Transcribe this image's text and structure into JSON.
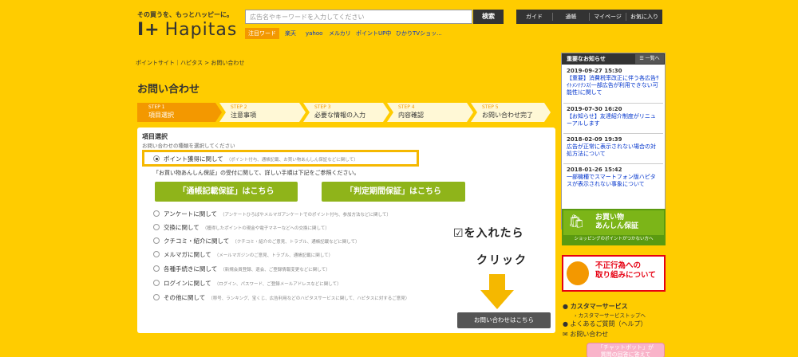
{
  "header": {
    "tagline": "その買うを、もっとハッピーに。",
    "logo": "Hapitas",
    "search_placeholder": "広告名やキーワードを入力してください",
    "search_button": "検索",
    "hotword_label": "注目ワード",
    "keywords": [
      "楽天",
      "yahoo",
      "メルカリ",
      "ポイントUP中",
      "ひかりTVショッ..."
    ],
    "nav": [
      "ガイド",
      "通帳",
      "マイページ",
      "お気に入り"
    ]
  },
  "breadcrumb": {
    "items": [
      "ポイントサイト｜ハピタス",
      "お問い合わせ"
    ],
    "separator": ">"
  },
  "page_title": "お問い合わせ",
  "steps": [
    {
      "num": "STEP 1",
      "label": "項目選択"
    },
    {
      "num": "STEP 2",
      "label": "注意事項"
    },
    {
      "num": "STEP 3",
      "label": "必要な情報の入力"
    },
    {
      "num": "STEP 4",
      "label": "内容確認"
    },
    {
      "num": "STEP 5",
      "label": "お問い合わせ完了"
    }
  ],
  "form": {
    "section_title": "項目選択",
    "section_sub": "お問い合わせの種類を選択してください",
    "selected_option": {
      "label": "ポイント獲得に関して",
      "note": "（ポイント付与、通帳記載、お買い物あんしん保証などに関して）"
    },
    "info_text": "「お買い物あんしん保証」の受付に関して、詳しい手順は下記をご参照ください。",
    "btn_bankbook": "「通帳記載保証」はこちら",
    "btn_judgement": "「判定期間保証」はこちら",
    "options": [
      {
        "label": "アンケートに関して",
        "note": "（アンケートひろばやメルマガアンケートでのポイント付与、参加方法などに関して）"
      },
      {
        "label": "交換に関して",
        "note": "（獲得したポイントの現金や電子マネーなどへの交換に関して）"
      },
      {
        "label": "クチコミ・紹介に関して",
        "note": "（クチコミ・紹介のご意見、トラブル、通帳記載などに関して）"
      },
      {
        "label": "メルマガに関して",
        "note": "（メールマガジンのご意見、トラブル、通帳記載に関して）"
      },
      {
        "label": "各種手続きに関して",
        "note": "（新規会員登録、退会、ご登録情報変更などに関して）"
      },
      {
        "label": "ログインに関して",
        "note": "（ログイン、パスワード、ご登録メールアドレスなどに関して）"
      },
      {
        "label": "その他に関して",
        "note": "（称号、ランキング、宝くじ、広告利用などのハピタスサービスに関して、ハピタスに対するご意見）"
      }
    ],
    "submit": "お問い合わせはこちら"
  },
  "annotation": {
    "line1": "☑を入れたら",
    "line2": "クリック"
  },
  "sidebar": {
    "news_title": "重要なお知らせ",
    "news_all": "一覧へ",
    "news": [
      {
        "date": "2019-09-27 15:30",
        "text": "【重要】消費税率改正に伴う各広告ｻｲﾄﾒﾝﾃﾅﾝｽ(一部広告が利用できない可能性)に関して"
      },
      {
        "date": "2019-07-30 16:20",
        "text": "【お知らせ】友達紹介制度がリニューアルします"
      },
      {
        "date": "2018-02-09 19:39",
        "text": "広告が正常に表示されない場合の対処方法について"
      },
      {
        "date": "2018-01-26 15:42",
        "text": "一部機種でスマートフォン版ハピタスが表示されない事象について"
      }
    ],
    "banner1_title": "お買い物\nあんしん保証",
    "banner1_sub": "ショッピングのポイントがつかない方へ",
    "banner2_title": "不正行為への\n取り組みについて",
    "cs_title": "カスタマーサービス",
    "cs_top": "カスタマーサービストップへ",
    "faq": "よくあるご質問（ヘルプ）",
    "contact": "お問い合わせ",
    "chat": "「チャットボット」が\n質問の回答に答えて"
  },
  "colors": {
    "background": "#ffcc00",
    "accent_orange": "#f39800",
    "green": "#8fb41a",
    "highlight": "#f5b800"
  }
}
